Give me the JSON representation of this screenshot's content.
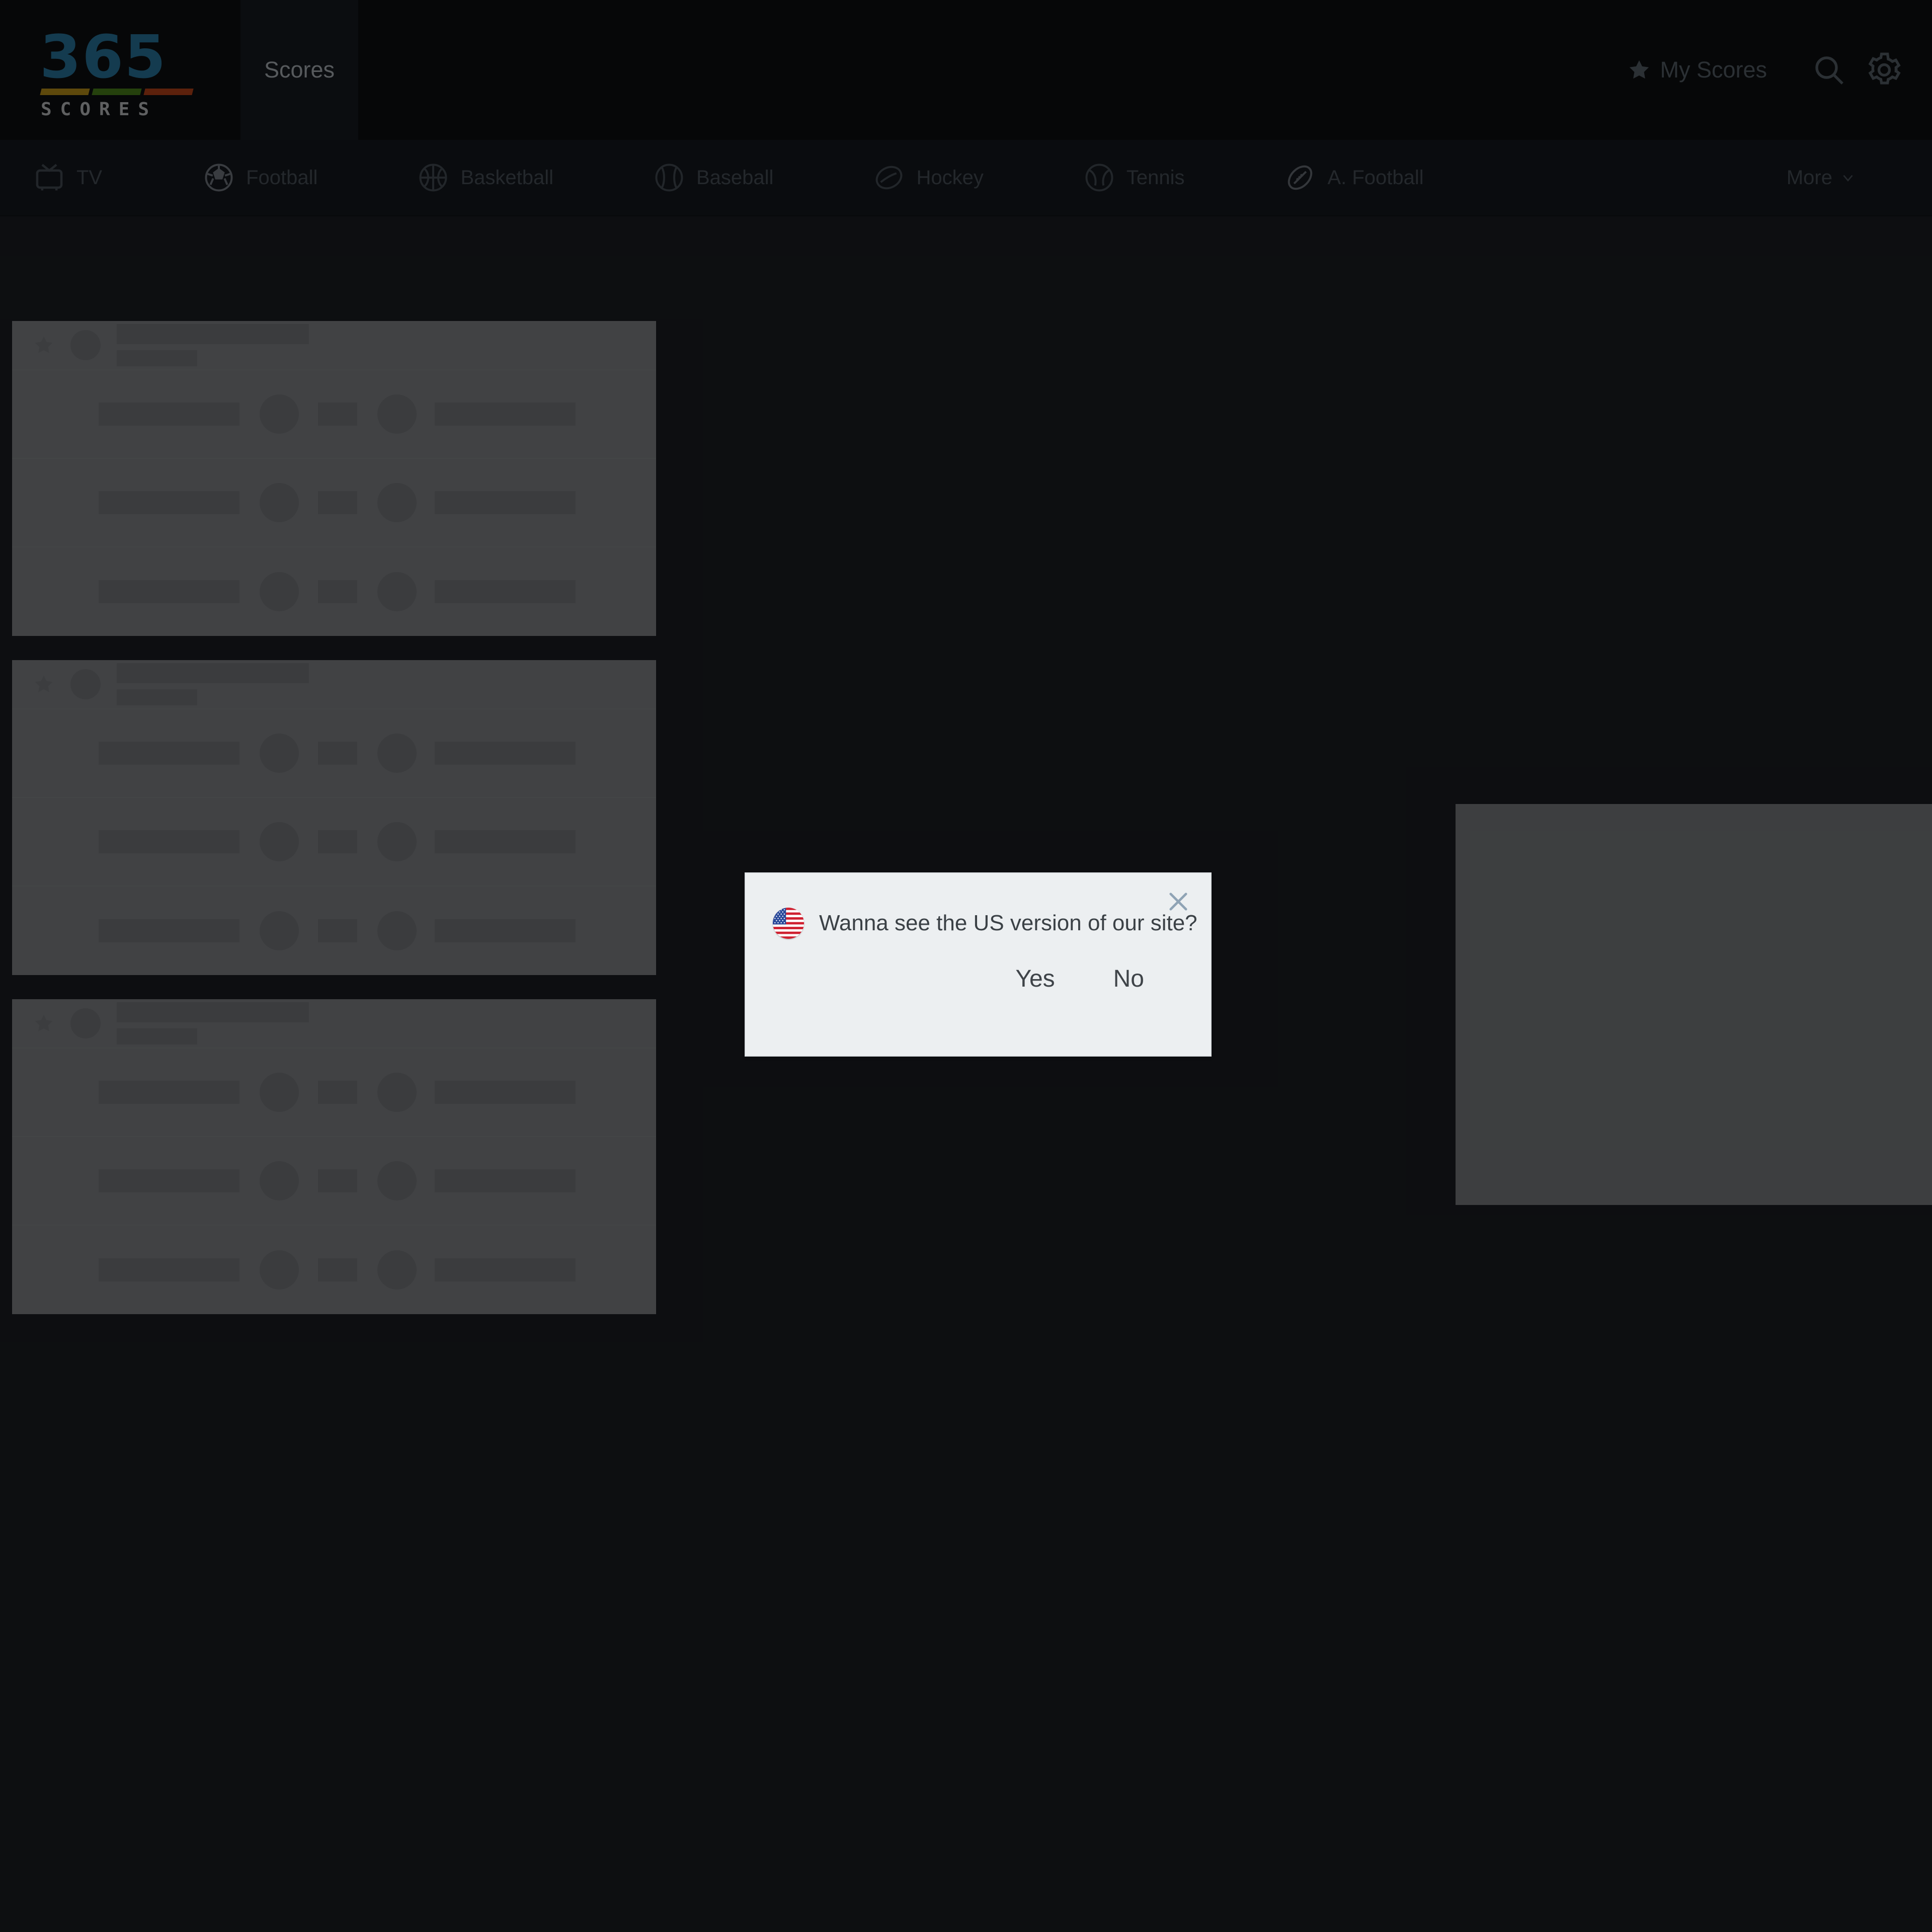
{
  "header": {
    "logo": {
      "digits": "365",
      "wordmark": "SCORES",
      "color_primary": "#2b7da8",
      "bar_colors": [
        "#c79b1a",
        "#4f8a1d",
        "#c4471a"
      ]
    },
    "active_tab": "Scores",
    "my_scores_label": "My Scores",
    "icons": {
      "star": "star-icon",
      "search": "search-icon",
      "settings": "gear-icon"
    }
  },
  "sportnav": {
    "items": [
      {
        "label": "TV",
        "icon": "tv-icon"
      },
      {
        "label": "Football",
        "icon": "soccer-ball-icon"
      },
      {
        "label": "Basketball",
        "icon": "basketball-icon"
      },
      {
        "label": "Baseball",
        "icon": "baseball-icon"
      },
      {
        "label": "Hockey",
        "icon": "hockey-puck-icon"
      },
      {
        "label": "Tennis",
        "icon": "tennis-ball-icon"
      },
      {
        "label": "A. Football",
        "icon": "american-football-icon"
      }
    ],
    "more_label": "More",
    "more_icon": "chevron-down-icon",
    "text_color": "#4d555e"
  },
  "content": {
    "state": "loading",
    "skeleton_cards": [
      {
        "rows": 3
      },
      {
        "rows": 3
      },
      {
        "rows": 3
      }
    ],
    "right_panel": {
      "state": "loading"
    }
  },
  "modal": {
    "name": "us-version-prompt",
    "message": "Wanna see the US version of our site?",
    "flag": "us-flag-icon",
    "close_icon": "close-icon",
    "buttons": [
      {
        "label": "Yes",
        "name": "yes-button"
      },
      {
        "label": "No",
        "name": "no-button"
      }
    ],
    "background": "#eceff1",
    "text_color": "#3b4146",
    "close_color": "#8fa3b5"
  },
  "overlay": {
    "color": "#000000",
    "opacity": 0.53
  }
}
